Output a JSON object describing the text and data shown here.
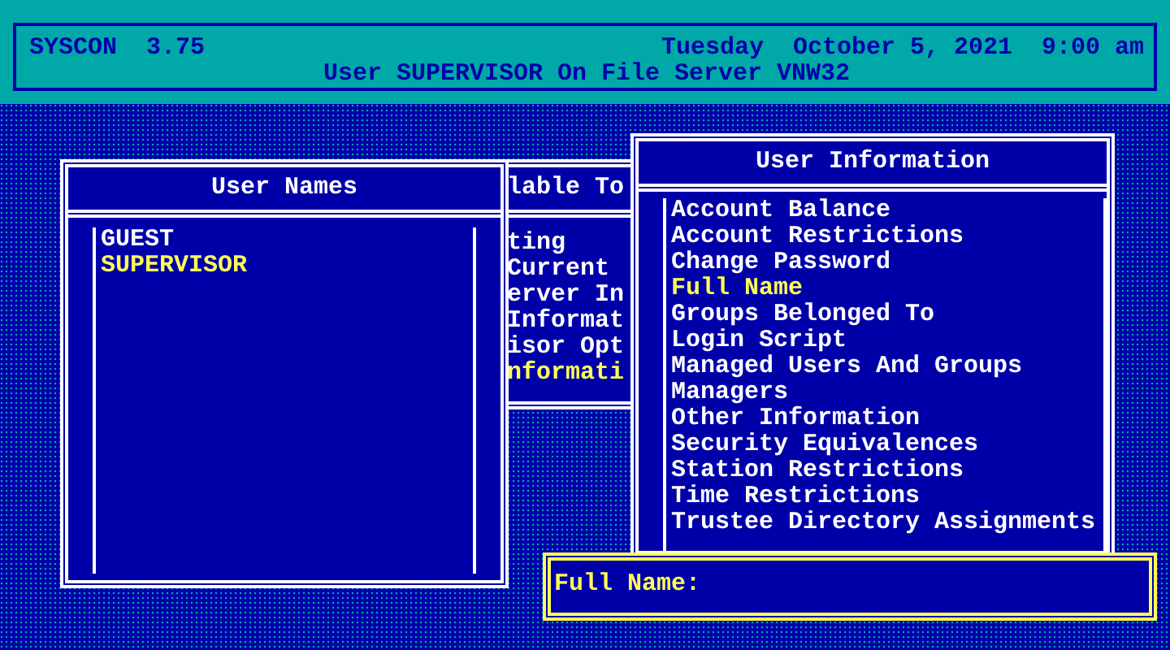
{
  "header": {
    "program": "SYSCON",
    "version": "3.75",
    "date": "Tuesday  October 5, 2021",
    "time": "9:00 am",
    "status": "User SUPERVISOR On File Server VNW32"
  },
  "available_topics": {
    "title": "lable To",
    "items": [
      {
        "label": "ting",
        "selected": false
      },
      {
        "label": "Current",
        "selected": false
      },
      {
        "label": "erver In",
        "selected": false
      },
      {
        "label": "Informat",
        "selected": false
      },
      {
        "label": "isor Opt",
        "selected": false
      },
      {
        "label": "nformati",
        "selected": true
      }
    ]
  },
  "user_names": {
    "title": "User Names",
    "items": [
      {
        "label": "GUEST",
        "selected": false
      },
      {
        "label": "SUPERVISOR",
        "selected": true
      }
    ]
  },
  "user_information": {
    "title": "User Information",
    "items": [
      {
        "label": "Account Balance",
        "selected": false
      },
      {
        "label": "Account Restrictions",
        "selected": false
      },
      {
        "label": "Change Password",
        "selected": false
      },
      {
        "label": "Full Name",
        "selected": true
      },
      {
        "label": "Groups Belonged To",
        "selected": false
      },
      {
        "label": "Login Script",
        "selected": false
      },
      {
        "label": "Managed Users And Groups",
        "selected": false
      },
      {
        "label": "Managers",
        "selected": false
      },
      {
        "label": "Other Information",
        "selected": false
      },
      {
        "label": "Security Equivalences",
        "selected": false
      },
      {
        "label": "Station Restrictions",
        "selected": false
      },
      {
        "label": "Time Restrictions",
        "selected": false
      },
      {
        "label": "Trustee Directory Assignments",
        "selected": false
      }
    ]
  },
  "full_name_prompt": {
    "label": "Full Name:"
  }
}
